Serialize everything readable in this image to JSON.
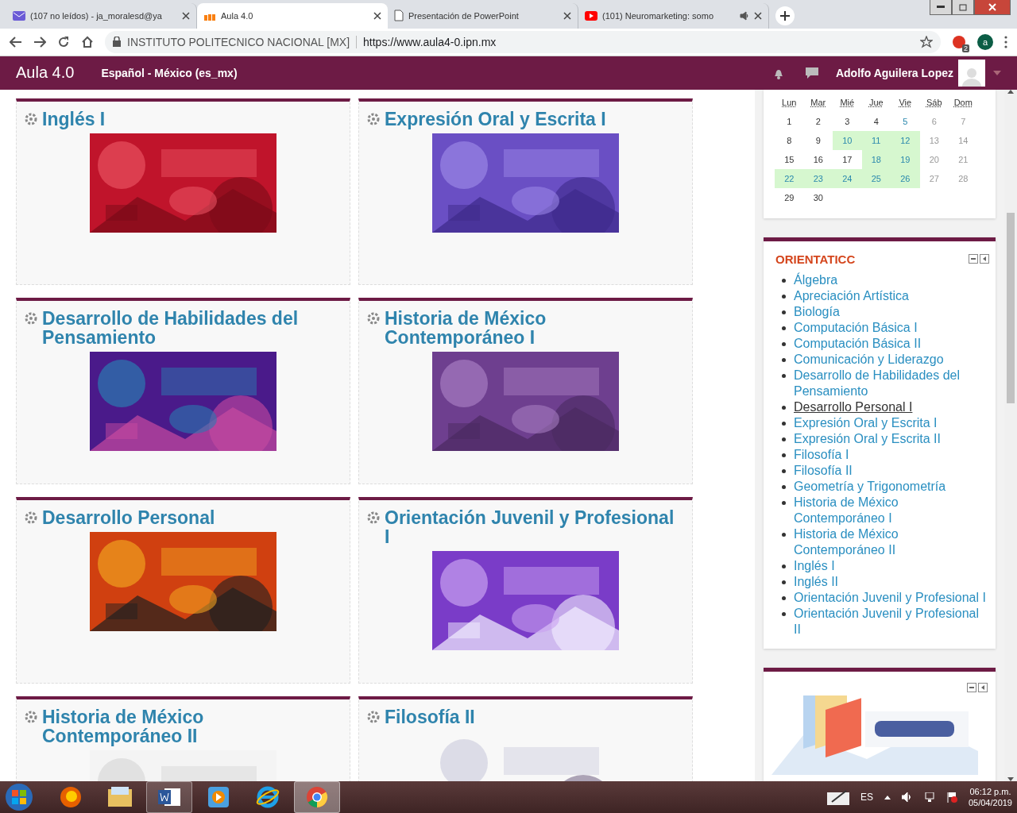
{
  "browser": {
    "tabs": [
      {
        "kind": "mail",
        "title": "(107 no leídos) - ja_moralesd@ya",
        "selected": false,
        "audio": false
      },
      {
        "kind": "moodle",
        "title": "Aula 4.0",
        "selected": true,
        "audio": false
      },
      {
        "kind": "document",
        "title": "Presentación de PowerPoint",
        "selected": false,
        "audio": false
      },
      {
        "kind": "video",
        "title": "(101) Neuromarketing: somo",
        "selected": false,
        "audio": true
      }
    ],
    "address": {
      "site_label": "INSTITUTO POLITECNICO NACIONAL [MX]",
      "url": "https://www.aula4-0.ipn.mx"
    },
    "extension_badge": "2",
    "profile_initial": "a"
  },
  "navbar": {
    "brand": "Aula 4.0",
    "language": "Español - México (es_mx)",
    "user": "Adolfo Aguilera Lopez"
  },
  "courses": [
    {
      "title": "Inglés I"
    },
    {
      "title": "Expresión Oral y Escrita I"
    },
    {
      "title": "Desarrollo de Habilidades del Pensamiento"
    },
    {
      "title": "Historia de México Contemporáneo I"
    },
    {
      "title": "Desarrollo Personal"
    },
    {
      "title": "Orientación Juvenil y Profesional I"
    },
    {
      "title": "Historia de México Contemporáneo II"
    },
    {
      "title": "Filosofía II"
    }
  ],
  "calendar": {
    "weekdays": [
      "Lun",
      "Mar",
      "Mié",
      "Jue",
      "Vie",
      "Sáb",
      "Dom"
    ],
    "days": [
      {
        "day": "1",
        "event": false,
        "highlighted": false,
        "weekend": false
      },
      {
        "day": "2",
        "event": false,
        "highlighted": false,
        "weekend": false
      },
      {
        "day": "3",
        "event": false,
        "highlighted": false,
        "weekend": false
      },
      {
        "day": "4",
        "event": false,
        "highlighted": false,
        "weekend": false
      },
      {
        "day": "5",
        "event": true,
        "highlighted": false,
        "weekend": false
      },
      {
        "day": "6",
        "event": false,
        "highlighted": false,
        "weekend": true
      },
      {
        "day": "7",
        "event": false,
        "highlighted": false,
        "weekend": true
      },
      {
        "day": "8",
        "event": false,
        "highlighted": false,
        "weekend": false
      },
      {
        "day": "9",
        "event": false,
        "highlighted": false,
        "weekend": false
      },
      {
        "day": "10",
        "event": true,
        "highlighted": true,
        "weekend": false
      },
      {
        "day": "11",
        "event": true,
        "highlighted": true,
        "weekend": false
      },
      {
        "day": "12",
        "event": true,
        "highlighted": true,
        "weekend": false
      },
      {
        "day": "13",
        "event": false,
        "highlighted": false,
        "weekend": true
      },
      {
        "day": "14",
        "event": false,
        "highlighted": false,
        "weekend": true
      },
      {
        "day": "15",
        "event": false,
        "highlighted": false,
        "weekend": false
      },
      {
        "day": "16",
        "event": false,
        "highlighted": false,
        "weekend": false
      },
      {
        "day": "17",
        "event": false,
        "highlighted": false,
        "weekend": false
      },
      {
        "day": "18",
        "event": true,
        "highlighted": true,
        "weekend": false
      },
      {
        "day": "19",
        "event": true,
        "highlighted": true,
        "weekend": false
      },
      {
        "day": "20",
        "event": false,
        "highlighted": false,
        "weekend": true
      },
      {
        "day": "21",
        "event": false,
        "highlighted": false,
        "weekend": true
      },
      {
        "day": "22",
        "event": true,
        "highlighted": true,
        "weekend": false
      },
      {
        "day": "23",
        "event": true,
        "highlighted": true,
        "weekend": false
      },
      {
        "day": "24",
        "event": true,
        "highlighted": true,
        "weekend": false
      },
      {
        "day": "25",
        "event": true,
        "highlighted": true,
        "weekend": false
      },
      {
        "day": "26",
        "event": true,
        "highlighted": true,
        "weekend": false
      },
      {
        "day": "27",
        "event": false,
        "highlighted": false,
        "weekend": true
      },
      {
        "day": "28",
        "event": false,
        "highlighted": false,
        "weekend": true
      },
      {
        "day": "29",
        "event": false,
        "highlighted": false,
        "weekend": false
      },
      {
        "day": "30",
        "event": false,
        "highlighted": false,
        "weekend": false
      }
    ]
  },
  "orientaticc": {
    "title": "ORIENTATICC",
    "items": [
      {
        "label": "Álgebra",
        "hovered": false
      },
      {
        "label": "Apreciación Artística",
        "hovered": false
      },
      {
        "label": "Biología",
        "hovered": false
      },
      {
        "label": "Computación Básica I",
        "hovered": false
      },
      {
        "label": "Computación Básica II",
        "hovered": false
      },
      {
        "label": "Comunicación y Liderazgo",
        "hovered": false
      },
      {
        "label": "Desarrollo de Habilidades del Pensamiento",
        "hovered": false
      },
      {
        "label": "Desarrollo Personal I",
        "hovered": true
      },
      {
        "label": "Expresión Oral y Escrita I",
        "hovered": false
      },
      {
        "label": "Expresión Oral y Escrita II",
        "hovered": false
      },
      {
        "label": "Filosofía I",
        "hovered": false
      },
      {
        "label": "Filosofía II",
        "hovered": false
      },
      {
        "label": "Geometría y Trigonometría",
        "hovered": false
      },
      {
        "label": "Historia de México Contemporáneo I",
        "hovered": false
      },
      {
        "label": "Historia de México Contemporáneo II",
        "hovered": false
      },
      {
        "label": "Inglés I",
        "hovered": false
      },
      {
        "label": "Inglés II",
        "hovered": false
      },
      {
        "label": "Orientación Juvenil y Profesional I",
        "hovered": false
      },
      {
        "label": "Orientación Juvenil y Profesional II",
        "hovered": false
      }
    ]
  },
  "taskbar": {
    "apps": [
      {
        "kind": "firefox",
        "open": false,
        "selected": false
      },
      {
        "kind": "folder",
        "open": false,
        "selected": false
      },
      {
        "kind": "word",
        "open": true,
        "selected": false
      },
      {
        "kind": "media",
        "open": false,
        "selected": false
      },
      {
        "kind": "ie",
        "open": false,
        "selected": false
      },
      {
        "kind": "chrome",
        "open": true,
        "selected": true
      }
    ],
    "language": "ES",
    "time": "06:12 p.m.",
    "date": "05/04/2019"
  }
}
